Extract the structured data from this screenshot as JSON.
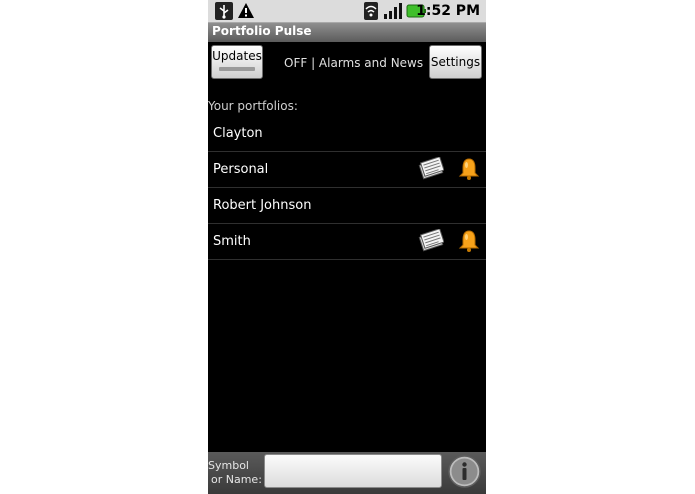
{
  "statusbar": {
    "time": "1:52 PM",
    "icons": [
      "usb-icon",
      "warning-icon",
      "wifi-icon",
      "signal-icon",
      "battery-icon"
    ]
  },
  "app": {
    "title": "Portfolio Pulse"
  },
  "toolbar": {
    "updates_label": "Updates",
    "status_text": "OFF | Alarms and News",
    "settings_label": "Settings"
  },
  "portfolios": {
    "label": "Your portfolios:",
    "items": [
      {
        "name": "Clayton",
        "news": false,
        "alarm": false
      },
      {
        "name": "Personal",
        "news": true,
        "alarm": true
      },
      {
        "name": "Robert Johnson",
        "news": false,
        "alarm": false
      },
      {
        "name": "Smith",
        "news": true,
        "alarm": true
      }
    ]
  },
  "search": {
    "label_line1": "Symbol",
    "label_line2": "or Name:",
    "value": "",
    "placeholder": ""
  },
  "colors": {
    "bell": "#f7a21a",
    "battery": "#3fbf2a",
    "background": "#000000"
  }
}
